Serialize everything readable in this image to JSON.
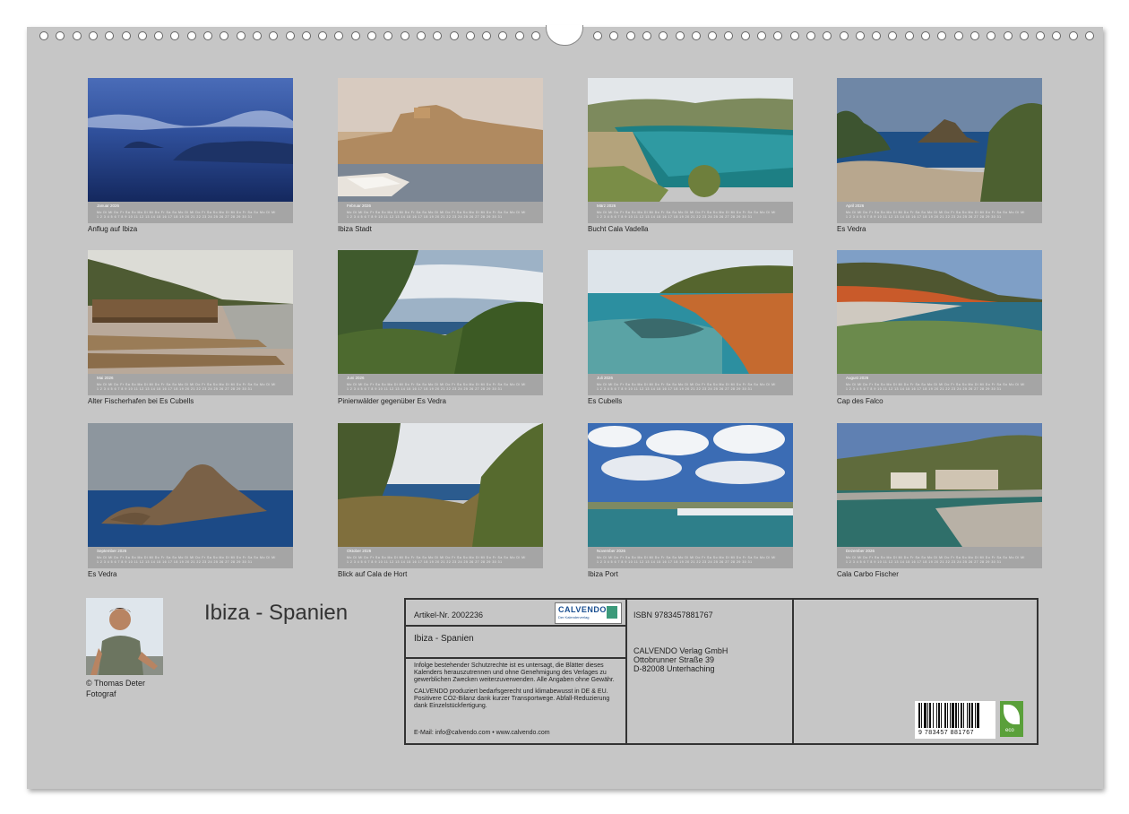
{
  "calendar": {
    "title": "Ibiza - Spanien",
    "months": [
      {
        "month": "Januar 2026",
        "caption": "Anflug auf Ibiza"
      },
      {
        "month": "Februar 2026",
        "caption": "Ibiza Stadt"
      },
      {
        "month": "März 2026",
        "caption": "Bucht Cala Vadella"
      },
      {
        "month": "April 2026",
        "caption": "Es Vedra"
      },
      {
        "month": "Mai 2026",
        "caption": "Alter Fischerhafen bei Es Cubells"
      },
      {
        "month": "Juni 2026",
        "caption": "Pinienwälder gegenüber Es Vedra"
      },
      {
        "month": "Juli 2026",
        "caption": "Es Cubells"
      },
      {
        "month": "August 2026",
        "caption": "Cap des Falco"
      },
      {
        "month": "September 2026",
        "caption": "Es Vedra"
      },
      {
        "month": "Oktober 2026",
        "caption": "Blick auf Cala de Hort"
      },
      {
        "month": "November 2026",
        "caption": "Ibiza Port"
      },
      {
        "month": "Dezember 2026",
        "caption": "Cala Carbo Fischer"
      }
    ],
    "days_row": "1 2 3 4 5 6 7 8 9 10 11 12 13 14 15 16 17 18 19 20 21 22 23 24 25 26 27 28 29 30 31",
    "weekday_row": "Mo Di Mi Do Fr Sa So Mo Di Mi Do Fr Sa So Mo Di Mi Do Fr Sa So Mo Di Mi Do Fr Sa So Mo Di Mi"
  },
  "author": {
    "name": "© Thomas Deter",
    "role": "Fotograf"
  },
  "info": {
    "article": "Artikel-Nr. 2002236",
    "logo": "CALVENDO",
    "logo_sub": "Der Kalenderverlag",
    "subtitle": "Ibiza - Spanien",
    "legal1": "Infolge bestehender Schutzrechte ist es untersagt, die Blätter dieses Kalenders herauszutrennen und ohne Genehmigung des Verlages zu gewerblichen Zwecken weiterzuverwenden. Alle Angaben ohne Gewähr.",
    "legal2": "CALVENDO produziert bedarfsgerecht und klimabewusst in DE & EU. Positivere CO2-Bilanz dank kurzer Transportwege. Abfall-Reduzierung dank Einzelstückfertigung.",
    "email": "E-Mail: info@calvendo.com • www.calvendo.com",
    "isbn": "ISBN 9783457881767",
    "publisher": "CALVENDO Verlag GmbH",
    "street": "Ottobrunner Straße 39",
    "city": "D-82008 Unterhaching",
    "barcode_number": "9 783457 881767",
    "eco_label": "eco"
  }
}
